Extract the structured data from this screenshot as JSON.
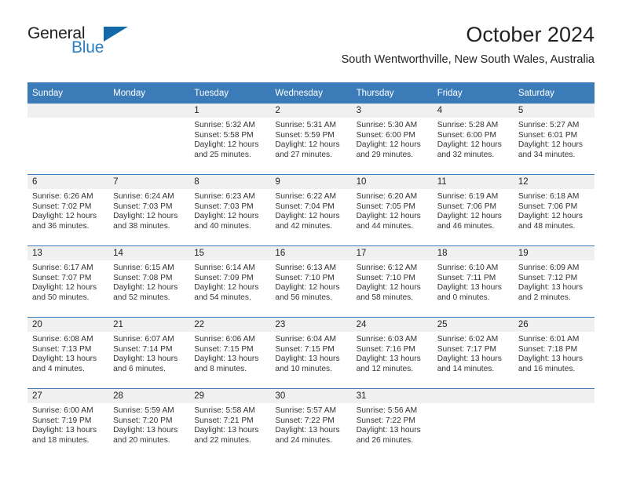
{
  "brand": {
    "name_part1": "General",
    "name_part2": "Blue",
    "triangle_color": "#1368a8",
    "blue_color": "#2a7fc4"
  },
  "header": {
    "month_title": "October 2024",
    "location": "South Wentworthville, New South Wales, Australia"
  },
  "theme": {
    "header_blue": "#3b7cb8",
    "day_band_gray": "#f0f0f0"
  },
  "weekday_headers": [
    "Sunday",
    "Monday",
    "Tuesday",
    "Wednesday",
    "Thursday",
    "Friday",
    "Saturday"
  ],
  "labels": {
    "sunrise_prefix": "Sunrise:",
    "sunset_prefix": "Sunset:",
    "daylight_prefix": "Daylight:"
  },
  "weeks": [
    [
      {
        "day": "",
        "sunrise": "",
        "sunset": "",
        "daylight_line1": "",
        "daylight_line2": "",
        "empty": true
      },
      {
        "day": "",
        "sunrise": "",
        "sunset": "",
        "daylight_line1": "",
        "daylight_line2": "",
        "empty": true
      },
      {
        "day": "1",
        "sunrise": "Sunrise: 5:32 AM",
        "sunset": "Sunset: 5:58 PM",
        "daylight_line1": "Daylight: 12 hours",
        "daylight_line2": "and 25 minutes.",
        "empty": false
      },
      {
        "day": "2",
        "sunrise": "Sunrise: 5:31 AM",
        "sunset": "Sunset: 5:59 PM",
        "daylight_line1": "Daylight: 12 hours",
        "daylight_line2": "and 27 minutes.",
        "empty": false
      },
      {
        "day": "3",
        "sunrise": "Sunrise: 5:30 AM",
        "sunset": "Sunset: 6:00 PM",
        "daylight_line1": "Daylight: 12 hours",
        "daylight_line2": "and 29 minutes.",
        "empty": false
      },
      {
        "day": "4",
        "sunrise": "Sunrise: 5:28 AM",
        "sunset": "Sunset: 6:00 PM",
        "daylight_line1": "Daylight: 12 hours",
        "daylight_line2": "and 32 minutes.",
        "empty": false
      },
      {
        "day": "5",
        "sunrise": "Sunrise: 5:27 AM",
        "sunset": "Sunset: 6:01 PM",
        "daylight_line1": "Daylight: 12 hours",
        "daylight_line2": "and 34 minutes.",
        "empty": false
      }
    ],
    [
      {
        "day": "6",
        "sunrise": "Sunrise: 6:26 AM",
        "sunset": "Sunset: 7:02 PM",
        "daylight_line1": "Daylight: 12 hours",
        "daylight_line2": "and 36 minutes.",
        "empty": false
      },
      {
        "day": "7",
        "sunrise": "Sunrise: 6:24 AM",
        "sunset": "Sunset: 7:03 PM",
        "daylight_line1": "Daylight: 12 hours",
        "daylight_line2": "and 38 minutes.",
        "empty": false
      },
      {
        "day": "8",
        "sunrise": "Sunrise: 6:23 AM",
        "sunset": "Sunset: 7:03 PM",
        "daylight_line1": "Daylight: 12 hours",
        "daylight_line2": "and 40 minutes.",
        "empty": false
      },
      {
        "day": "9",
        "sunrise": "Sunrise: 6:22 AM",
        "sunset": "Sunset: 7:04 PM",
        "daylight_line1": "Daylight: 12 hours",
        "daylight_line2": "and 42 minutes.",
        "empty": false
      },
      {
        "day": "10",
        "sunrise": "Sunrise: 6:20 AM",
        "sunset": "Sunset: 7:05 PM",
        "daylight_line1": "Daylight: 12 hours",
        "daylight_line2": "and 44 minutes.",
        "empty": false
      },
      {
        "day": "11",
        "sunrise": "Sunrise: 6:19 AM",
        "sunset": "Sunset: 7:06 PM",
        "daylight_line1": "Daylight: 12 hours",
        "daylight_line2": "and 46 minutes.",
        "empty": false
      },
      {
        "day": "12",
        "sunrise": "Sunrise: 6:18 AM",
        "sunset": "Sunset: 7:06 PM",
        "daylight_line1": "Daylight: 12 hours",
        "daylight_line2": "and 48 minutes.",
        "empty": false
      }
    ],
    [
      {
        "day": "13",
        "sunrise": "Sunrise: 6:17 AM",
        "sunset": "Sunset: 7:07 PM",
        "daylight_line1": "Daylight: 12 hours",
        "daylight_line2": "and 50 minutes.",
        "empty": false
      },
      {
        "day": "14",
        "sunrise": "Sunrise: 6:15 AM",
        "sunset": "Sunset: 7:08 PM",
        "daylight_line1": "Daylight: 12 hours",
        "daylight_line2": "and 52 minutes.",
        "empty": false
      },
      {
        "day": "15",
        "sunrise": "Sunrise: 6:14 AM",
        "sunset": "Sunset: 7:09 PM",
        "daylight_line1": "Daylight: 12 hours",
        "daylight_line2": "and 54 minutes.",
        "empty": false
      },
      {
        "day": "16",
        "sunrise": "Sunrise: 6:13 AM",
        "sunset": "Sunset: 7:10 PM",
        "daylight_line1": "Daylight: 12 hours",
        "daylight_line2": "and 56 minutes.",
        "empty": false
      },
      {
        "day": "17",
        "sunrise": "Sunrise: 6:12 AM",
        "sunset": "Sunset: 7:10 PM",
        "daylight_line1": "Daylight: 12 hours",
        "daylight_line2": "and 58 minutes.",
        "empty": false
      },
      {
        "day": "18",
        "sunrise": "Sunrise: 6:10 AM",
        "sunset": "Sunset: 7:11 PM",
        "daylight_line1": "Daylight: 13 hours",
        "daylight_line2": "and 0 minutes.",
        "empty": false
      },
      {
        "day": "19",
        "sunrise": "Sunrise: 6:09 AM",
        "sunset": "Sunset: 7:12 PM",
        "daylight_line1": "Daylight: 13 hours",
        "daylight_line2": "and 2 minutes.",
        "empty": false
      }
    ],
    [
      {
        "day": "20",
        "sunrise": "Sunrise: 6:08 AM",
        "sunset": "Sunset: 7:13 PM",
        "daylight_line1": "Daylight: 13 hours",
        "daylight_line2": "and 4 minutes.",
        "empty": false
      },
      {
        "day": "21",
        "sunrise": "Sunrise: 6:07 AM",
        "sunset": "Sunset: 7:14 PM",
        "daylight_line1": "Daylight: 13 hours",
        "daylight_line2": "and 6 minutes.",
        "empty": false
      },
      {
        "day": "22",
        "sunrise": "Sunrise: 6:06 AM",
        "sunset": "Sunset: 7:15 PM",
        "daylight_line1": "Daylight: 13 hours",
        "daylight_line2": "and 8 minutes.",
        "empty": false
      },
      {
        "day": "23",
        "sunrise": "Sunrise: 6:04 AM",
        "sunset": "Sunset: 7:15 PM",
        "daylight_line1": "Daylight: 13 hours",
        "daylight_line2": "and 10 minutes.",
        "empty": false
      },
      {
        "day": "24",
        "sunrise": "Sunrise: 6:03 AM",
        "sunset": "Sunset: 7:16 PM",
        "daylight_line1": "Daylight: 13 hours",
        "daylight_line2": "and 12 minutes.",
        "empty": false
      },
      {
        "day": "25",
        "sunrise": "Sunrise: 6:02 AM",
        "sunset": "Sunset: 7:17 PM",
        "daylight_line1": "Daylight: 13 hours",
        "daylight_line2": "and 14 minutes.",
        "empty": false
      },
      {
        "day": "26",
        "sunrise": "Sunrise: 6:01 AM",
        "sunset": "Sunset: 7:18 PM",
        "daylight_line1": "Daylight: 13 hours",
        "daylight_line2": "and 16 minutes.",
        "empty": false
      }
    ],
    [
      {
        "day": "27",
        "sunrise": "Sunrise: 6:00 AM",
        "sunset": "Sunset: 7:19 PM",
        "daylight_line1": "Daylight: 13 hours",
        "daylight_line2": "and 18 minutes.",
        "empty": false
      },
      {
        "day": "28",
        "sunrise": "Sunrise: 5:59 AM",
        "sunset": "Sunset: 7:20 PM",
        "daylight_line1": "Daylight: 13 hours",
        "daylight_line2": "and 20 minutes.",
        "empty": false
      },
      {
        "day": "29",
        "sunrise": "Sunrise: 5:58 AM",
        "sunset": "Sunset: 7:21 PM",
        "daylight_line1": "Daylight: 13 hours",
        "daylight_line2": "and 22 minutes.",
        "empty": false
      },
      {
        "day": "30",
        "sunrise": "Sunrise: 5:57 AM",
        "sunset": "Sunset: 7:22 PM",
        "daylight_line1": "Daylight: 13 hours",
        "daylight_line2": "and 24 minutes.",
        "empty": false
      },
      {
        "day": "31",
        "sunrise": "Sunrise: 5:56 AM",
        "sunset": "Sunset: 7:22 PM",
        "daylight_line1": "Daylight: 13 hours",
        "daylight_line2": "and 26 minutes.",
        "empty": false
      },
      {
        "day": "",
        "sunrise": "",
        "sunset": "",
        "daylight_line1": "",
        "daylight_line2": "",
        "empty": true
      },
      {
        "day": "",
        "sunrise": "",
        "sunset": "",
        "daylight_line1": "",
        "daylight_line2": "",
        "empty": true
      }
    ]
  ]
}
